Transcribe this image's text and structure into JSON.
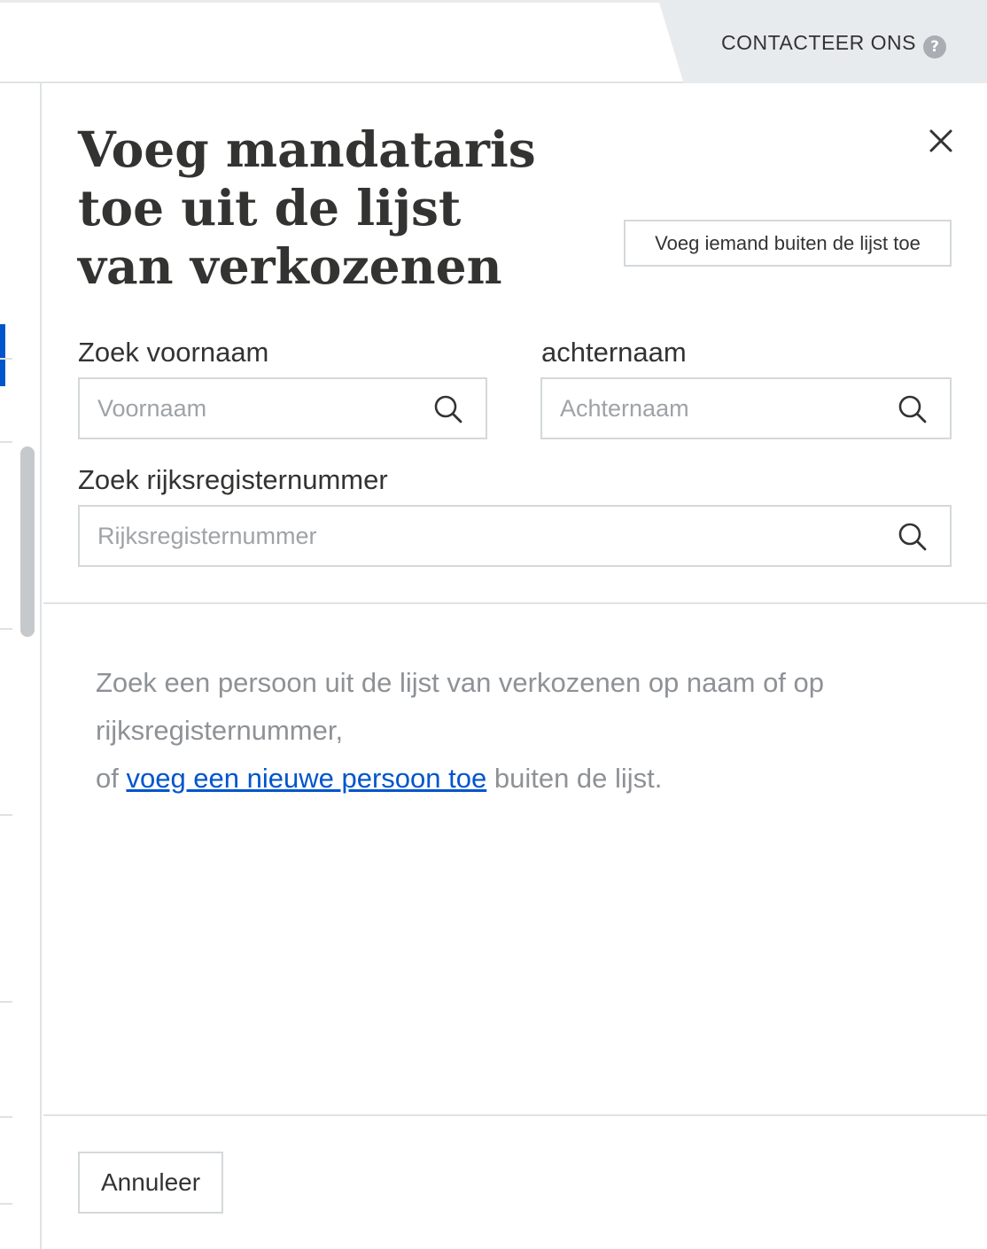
{
  "header": {
    "contact_label": "CONTACTEER ONS",
    "help_glyph": "?"
  },
  "panel": {
    "title": "Voeg mandataris toe uit de lijst van verkozenen",
    "add_outside_label": "Voeg iemand buiten de lijst toe",
    "first_name": {
      "label": "Zoek voornaam",
      "placeholder": "Voornaam",
      "value": ""
    },
    "last_name": {
      "label": "achternaam",
      "placeholder": "Achternaam",
      "value": ""
    },
    "national_number": {
      "label": "Zoek rijksregisternummer",
      "placeholder": "Rijksregisternummer",
      "value": ""
    },
    "info": {
      "line1": "Zoek een persoon uit de lijst van verkozenen op naam of op rijksregisternummer,",
      "prefix": "of ",
      "link": "voeg een nieuwe persoon toe",
      "suffix": " buiten de lijst."
    },
    "cancel_label": "Annuleer"
  },
  "icons": {
    "close": "close-icon",
    "search": "search-icon",
    "help": "question-icon"
  },
  "colors": {
    "link": "#0055cc",
    "text": "#333332",
    "muted": "#8e9296",
    "border": "#d4d8db",
    "header_bg": "#e8ebee"
  }
}
